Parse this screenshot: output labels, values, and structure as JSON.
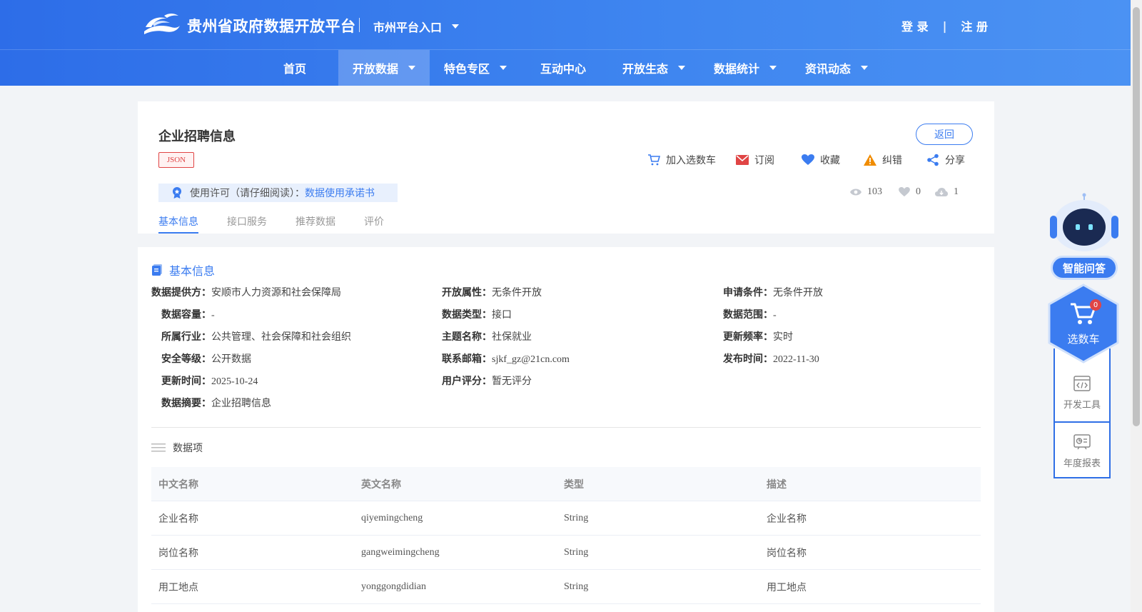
{
  "header": {
    "site_title": "贵州省政府数据开放平台",
    "city_entry": "市州平台入口",
    "login": "登 录",
    "auth_sep": "|",
    "register": "注 册"
  },
  "nav": [
    {
      "label": "首页",
      "dropdown": false
    },
    {
      "label": "开放数据",
      "dropdown": true,
      "active": true
    },
    {
      "label": "特色专区",
      "dropdown": true
    },
    {
      "label": "互动中心",
      "dropdown": false
    },
    {
      "label": "开放生态",
      "dropdown": true
    },
    {
      "label": "数据统计",
      "dropdown": true
    },
    {
      "label": "资讯动态",
      "dropdown": true
    }
  ],
  "dataset": {
    "title": "企业招聘信息",
    "format_tag": "JSON",
    "back_button": "返回",
    "actions": {
      "add_cart": "加入选数车",
      "subscribe": "订阅",
      "favorite": "收藏",
      "report_error": "纠错",
      "share": "分享"
    },
    "license_label": "使用许可（请仔细阅读）：",
    "license_link": "数据使用承诺书",
    "stats": {
      "views": "103",
      "likes": "0",
      "downloads": "1"
    },
    "tabs": [
      "基本信息",
      "接口服务",
      "推荐数据",
      "评价"
    ]
  },
  "basic_info": {
    "section_title": "基本信息",
    "fields": {
      "provider": {
        "k": "数据提供方：",
        "v": "安顺市人力资源和社会保障局"
      },
      "open_attr": {
        "k": "开放属性：",
        "v": "无条件开放"
      },
      "apply_cond": {
        "k": "申请条件：",
        "v": "无条件开放"
      },
      "capacity": {
        "k": "数据容量：",
        "v": "-"
      },
      "data_type": {
        "k": "数据类型：",
        "v": "接口"
      },
      "data_scope": {
        "k": "数据范围：",
        "v": "-"
      },
      "industry": {
        "k": "所属行业：",
        "v": "公共管理、社会保障和社会组织"
      },
      "theme": {
        "k": "主题名称：",
        "v": "社保就业"
      },
      "freq": {
        "k": "更新频率：",
        "v": "实时"
      },
      "security": {
        "k": "安全等级：",
        "v": "公开数据"
      },
      "email": {
        "k": "联系邮箱：",
        "v": "sjkf_gz@21cn.com"
      },
      "publish": {
        "k": "发布时间：",
        "v": "2022-11-30"
      },
      "updated": {
        "k": "更新时间：",
        "v": "2025-10-24"
      },
      "rating": {
        "k": "用户评分：",
        "v": "暂无评分"
      },
      "summary": {
        "k": "数据摘要：",
        "v": "企业招聘信息"
      }
    }
  },
  "data_items": {
    "title": "数据项",
    "columns": [
      "中文名称",
      "英文名称",
      "类型",
      "描述"
    ],
    "rows": [
      [
        "企业名称",
        "qiyemingcheng",
        "String",
        "企业名称"
      ],
      [
        "岗位名称",
        "gangweimingcheng",
        "String",
        "岗位名称"
      ],
      [
        "用工地点",
        "yonggongdidian",
        "String",
        "用工地点"
      ]
    ]
  },
  "float_panel": {
    "assistant": "智能问答",
    "cart_label": "选数车",
    "cart_count": "0",
    "dev_tools": "开发工具",
    "annual_report": "年度报表"
  },
  "colors": {
    "primary": "#3b7cf0",
    "header_start": "#2d6de8",
    "danger": "#e04545",
    "warning": "#f08c00"
  }
}
